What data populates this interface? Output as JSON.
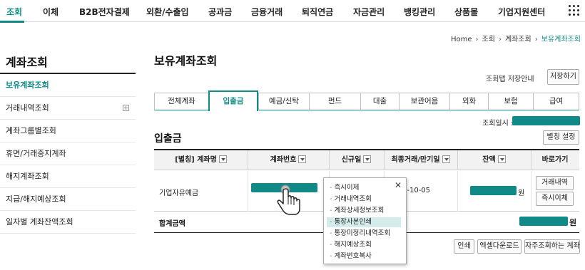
{
  "topnav": {
    "items": [
      "조회",
      "이체",
      "B2B전자결제",
      "외환/수출입",
      "공과금",
      "금융거래",
      "퇴직연금",
      "자금관리",
      "뱅킹관리",
      "상품몰",
      "기업지원센터"
    ],
    "active_index": 0
  },
  "breadcrumb": [
    "Home",
    "조회",
    "계좌조회",
    "보유계좌조회"
  ],
  "sidebar": {
    "title": "계좌조회",
    "items": [
      {
        "label": "보유계좌조회",
        "active": true
      },
      {
        "label": "거래내역조회",
        "expandable": true
      },
      {
        "label": "계좌그룹별조회"
      },
      {
        "label": "휴면/거래중지계좌"
      },
      {
        "label": "해지계좌조회"
      },
      {
        "label": "지급/해지예상조회"
      },
      {
        "label": "일자별 계좌잔액조회"
      }
    ],
    "expand_symbol": "+"
  },
  "main": {
    "title": "보유계좌조회",
    "guide_label": "조회탭 저장안내",
    "save_button": "저장하기",
    "tabs": [
      "전체계좌",
      "입출금",
      "예금/신탁",
      "펀드",
      "대출",
      "보관어음",
      "외화",
      "보험",
      "급여"
    ],
    "active_tab_index": 1,
    "inquiry_label": "조회일시 :",
    "section_title": "입출금",
    "column_settings_button": "별칭 설정"
  },
  "table": {
    "headers": [
      "[별칭] 계좌명",
      "계좌번호",
      "신규일",
      "최종거래/만기일",
      "잔액",
      "바로가기"
    ],
    "sortable": [
      true,
      true,
      true,
      true,
      true,
      false
    ],
    "row": {
      "account_name": "기업자유예금",
      "last_date_partial": "2-10-05",
      "balance_unit": "원",
      "shortcut_buttons": [
        "거래내역",
        "즉시이체"
      ]
    },
    "total_label": "합계금액",
    "total_unit": "원"
  },
  "footer_buttons": [
    "인쇄",
    "엑셀다운로드",
    "자주조회하는 계좌"
  ],
  "popup": {
    "close_symbol": "✕",
    "items": [
      "즉시이체",
      "거래내역조회",
      "계좌상세정보조회",
      "통장사본인쇄",
      "통장미정리내역조회",
      "해지예상조회",
      "계좌번호복사"
    ],
    "highlight_index": 3
  },
  "colors": {
    "accent": "#0f8a86",
    "highlight": "#d4ecec"
  }
}
